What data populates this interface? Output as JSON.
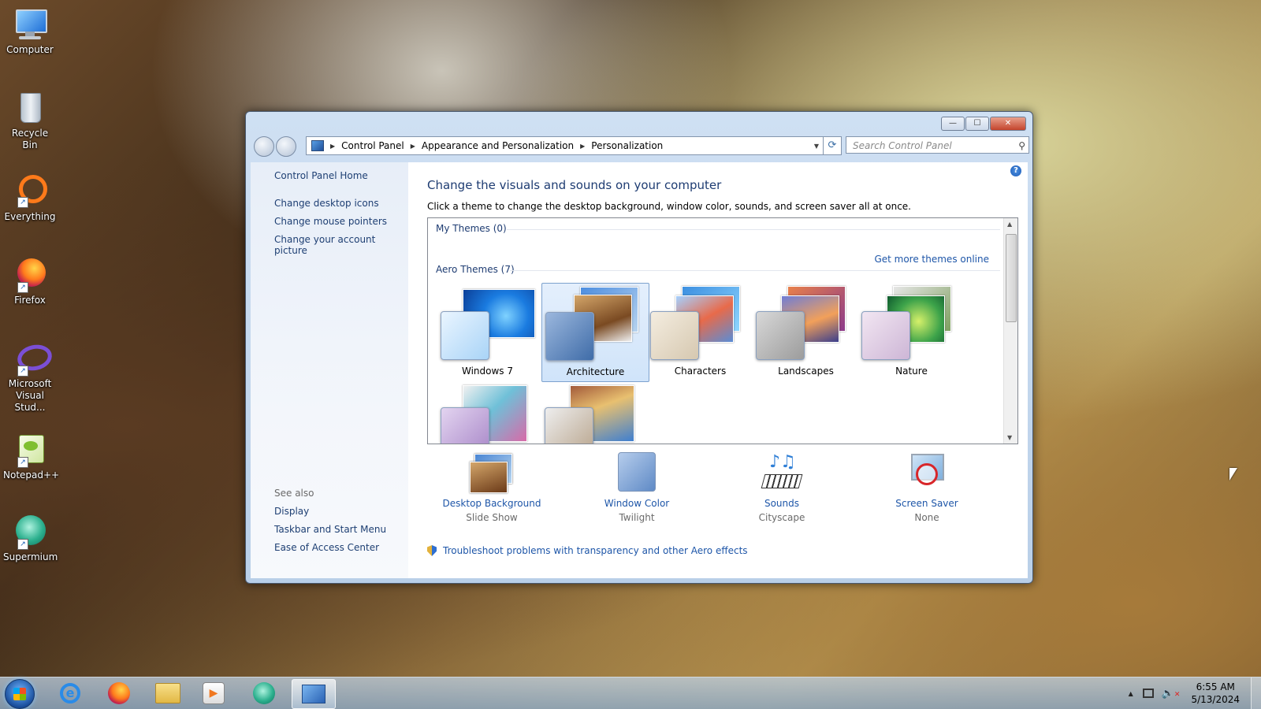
{
  "desktop": {
    "icons": [
      {
        "label": "Computer"
      },
      {
        "label": "Recycle Bin"
      },
      {
        "label": "Everything"
      },
      {
        "label": "Firefox"
      },
      {
        "label": "Microsoft Visual Stud..."
      },
      {
        "label": "Notepad++"
      },
      {
        "label": "Supermium"
      }
    ]
  },
  "window": {
    "caption": {
      "minimize": "—",
      "maximize": "☐",
      "close": "✕"
    },
    "breadcrumb": [
      "Control Panel",
      "Appearance and Personalization",
      "Personalization"
    ],
    "search_placeholder": "Search Control Panel",
    "help": "?"
  },
  "sidebar": {
    "home": "Control Panel Home",
    "links": [
      "Change desktop icons",
      "Change mouse pointers",
      "Change your account picture"
    ],
    "see_also_title": "See also",
    "see_also": [
      "Display",
      "Taskbar and Start Menu",
      "Ease of Access Center"
    ]
  },
  "main": {
    "heading": "Change the visuals and sounds on your computer",
    "subtitle": "Click a theme to change the desktop background, window color, sounds, and screen saver all at once.",
    "my_themes_label": "My Themes (0)",
    "get_more": "Get more themes online",
    "aero_themes_label": "Aero Themes (7)",
    "themes": [
      {
        "name": "Windows 7",
        "selected": false
      },
      {
        "name": "Architecture",
        "selected": true
      },
      {
        "name": "Characters",
        "selected": false
      },
      {
        "name": "Landscapes",
        "selected": false
      },
      {
        "name": "Nature",
        "selected": false
      }
    ],
    "settings": [
      {
        "label": "Desktop Background",
        "value": "Slide Show"
      },
      {
        "label": "Window Color",
        "value": "Twilight"
      },
      {
        "label": "Sounds",
        "value": "Cityscape"
      },
      {
        "label": "Screen Saver",
        "value": "None"
      }
    ],
    "troubleshoot": "Troubleshoot problems with transparency and other Aero effects"
  },
  "taskbar": {
    "time": "6:55 AM",
    "date": "5/13/2024",
    "tray_arrow": "▲"
  }
}
